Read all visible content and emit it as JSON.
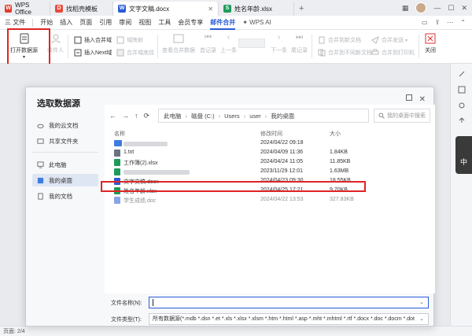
{
  "tabs": [
    {
      "label": "WPS Office",
      "color": "#e23a2e",
      "glyph": "W"
    },
    {
      "label": "找稻壳模板",
      "color": "#e84a3a",
      "glyph": "D"
    },
    {
      "label": "文字文稿.docx",
      "color": "#2a5cd6",
      "glyph": "W"
    },
    {
      "label": "姓名年龄.xlsx",
      "color": "#1e9b5a",
      "glyph": "S"
    }
  ],
  "menu": {
    "file": "三 文件",
    "items": [
      "开始",
      "插入",
      "页面",
      "引用",
      "审阅",
      "视图",
      "工具",
      "会员专享",
      "邮件合并"
    ],
    "active_index": 8,
    "wps_ai": "WPS AI"
  },
  "ribbon": {
    "open_source": "打开数据源",
    "recipients": "收件人",
    "insert_merge_field": "插入合并域",
    "insert_next_field": "插入Next域",
    "field_codes": "域映射",
    "merge_field_shading": "合并域底纹",
    "view_merged_data": "查看合并数据",
    "first_record": "首记录",
    "prev_record": "上一条",
    "next_record": "下一条",
    "last_record": "尾记录",
    "merge_to_new_doc": "合并到新文档",
    "merge_to_separate_docs": "合并到不同新文档",
    "merge_send": "合并发送",
    "merge_to_printer": "合并到打印机",
    "close": "关闭"
  },
  "dialog": {
    "title": "选取数据源",
    "sidebar": [
      "我的云文档",
      "共享文件夹",
      "此电脑",
      "我的桌面",
      "我的文档"
    ],
    "sidebar_selected": 3,
    "breadcrumb": [
      "此电脑",
      "磁盘 (C:)",
      "Users",
      "user",
      "我的桌面"
    ],
    "search_placeholder": "我的桌面中搜索",
    "columns": {
      "name": "名称",
      "date": "修改时间",
      "size": "大小"
    },
    "files": [
      {
        "name": "",
        "date": "2024/04/22 09:18",
        "size": "",
        "type": "folder",
        "color": "#3d7de0",
        "blurred": true
      },
      {
        "name": "1.txt",
        "date": "2024/04/09 11:36",
        "size": "1.84KB",
        "type": "txt",
        "color": "#6b7280",
        "blurred": false
      },
      {
        "name": "工作簿(2).xlsx",
        "date": "2024/04/24 11:05",
        "size": "11.85KB",
        "type": "xlsx",
        "color": "#1e9b5a",
        "blurred": false
      },
      {
        "name": "",
        "date": "2023/11/29 12:01",
        "size": "1.63MB",
        "type": "xlsx",
        "color": "#1e9b5a",
        "blurred": true
      },
      {
        "name": "文字文稿.docx",
        "date": "2024/04/23 09:30",
        "size": "18.55KB",
        "type": "docx",
        "color": "#2a5cd6",
        "blurred": false
      },
      {
        "name": "姓名年龄.xlsx",
        "date": "2024/04/25 17:21",
        "size": "9.70KB",
        "type": "xlsx",
        "color": "#1e9b5a",
        "blurred": false
      },
      {
        "name": "学生成绩.doc",
        "date": "2024/04/22 13:53",
        "size": "327.83KB",
        "type": "doc",
        "color": "#2a5cd6",
        "blurred": false
      }
    ],
    "filename_label": "文件名称(N):",
    "filename_value": "",
    "filetype_label": "文件类型(T):",
    "filetype_value": "所有数据源(*.mdb *.dsn *.et *.xls *.xlsx *.xlsm *.htm *.html *.asp *.mht *.mhtml *.rtf *.docx *.doc *.docm *.dot"
  },
  "status": {
    "page": "页面: 2/4"
  }
}
